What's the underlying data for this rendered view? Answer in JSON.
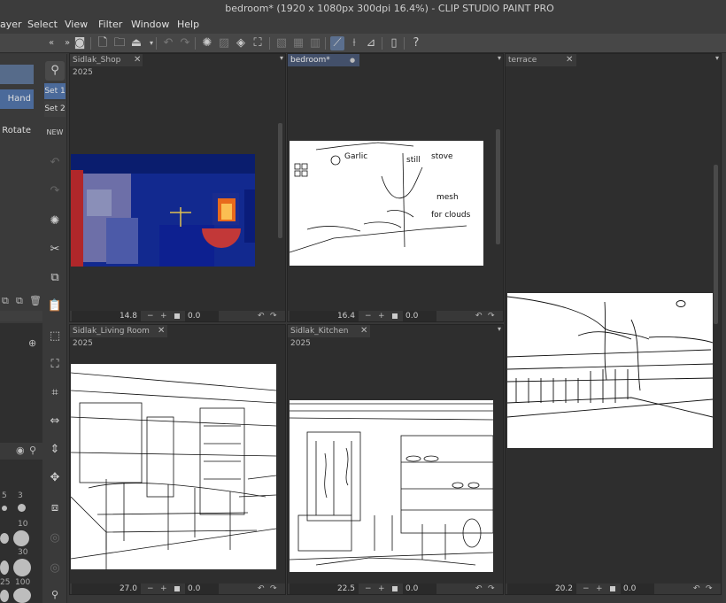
{
  "window": {
    "title": "bedroom* (1920 x 1080px 300dpi 16.4%)  - CLIP STUDIO PAINT PRO"
  },
  "menu": [
    "ayer",
    "Select",
    "View",
    "Filter",
    "Window",
    "Help"
  ],
  "left_panel": {
    "rows": [
      "Hand",
      "Rotate"
    ],
    "brush_sizes": [
      "5",
      "3",
      "10",
      "30",
      "25",
      "100"
    ]
  },
  "tool_sets": [
    "Set 1",
    "Set 2"
  ],
  "panes": [
    {
      "tab": "Sidlak_Shop 2025",
      "zoom": "14.8",
      "angle": "0.0"
    },
    {
      "tab": "bedroom*",
      "zoom": "16.4",
      "angle": "0.0"
    },
    {
      "tab": "terrace",
      "zoom": "20.2",
      "angle": "0.0"
    },
    {
      "tab": "Sidlak_Living Room 2025",
      "zoom": "27.0",
      "angle": "0.0"
    },
    {
      "tab": "Sidlak_Kitchen 2025",
      "zoom": "22.5",
      "angle": "0.0"
    }
  ],
  "sketch_notes": [
    "Garlic",
    "still",
    "stove",
    "mesh",
    "for clouds"
  ],
  "colors": {
    "accent": "#4b6a9a",
    "panel": "#383838",
    "canvas_bg": "#2e2e2e"
  }
}
